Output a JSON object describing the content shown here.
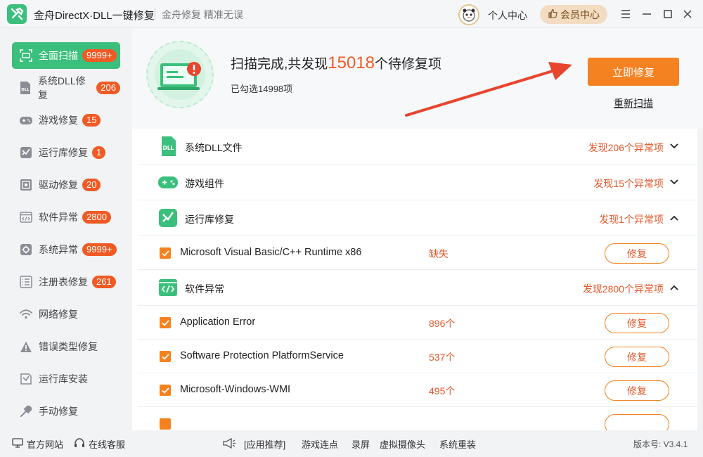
{
  "titlebar": {
    "app_title": "金舟DirectX·DLL一键修复",
    "slogan": "金舟修复 精准无误",
    "personal_center": "个人中心",
    "vip_center": "会员中心"
  },
  "sidebar": {
    "items": [
      {
        "label": "全面扫描",
        "badge": "9999+",
        "icon": "scan-icon"
      },
      {
        "label": "系统DLL修复",
        "badge": "206",
        "icon": "dll-icon"
      },
      {
        "label": "游戏修复",
        "badge": "15",
        "icon": "gamepad-icon"
      },
      {
        "label": "运行库修复",
        "badge": "1",
        "icon": "runtime-icon"
      },
      {
        "label": "驱动修复",
        "badge": "20",
        "icon": "driver-icon"
      },
      {
        "label": "软件异常",
        "badge": "2800",
        "icon": "code-icon"
      },
      {
        "label": "系统异常",
        "badge": "9999+",
        "icon": "gear-icon"
      },
      {
        "label": "注册表修复",
        "badge": "261",
        "icon": "registry-icon"
      },
      {
        "label": "网络修复",
        "badge": "",
        "icon": "wifi-icon"
      },
      {
        "label": "错误类型修复",
        "badge": "",
        "icon": "warning-icon"
      },
      {
        "label": "运行库安装",
        "badge": "",
        "icon": "install-icon"
      },
      {
        "label": "手动修复",
        "badge": "",
        "icon": "wrench-icon"
      }
    ]
  },
  "scan": {
    "title_prefix": "扫描完成,共发现",
    "count": "15018",
    "title_suffix": "个待修复项",
    "selected": "已勾选14998项",
    "fix_now": "立即修复",
    "rescan": "重新扫描"
  },
  "list": {
    "cat_dll": {
      "name": "系统DLL文件",
      "found": "发现206个异常项"
    },
    "cat_game": {
      "name": "游戏组件",
      "found": "发现15个异常项"
    },
    "cat_runtime": {
      "name": "运行库修复",
      "found": "发现1个异常项"
    },
    "runtime_items": [
      {
        "name": "Microsoft Visual Basic/C++ Runtime x86",
        "status": "缺失",
        "action": "修复"
      }
    ],
    "cat_software": {
      "name": "软件异常",
      "found": "发现2800个异常项"
    },
    "software_items": [
      {
        "name": "Application Error",
        "status": "896个",
        "action": "修复"
      },
      {
        "name": "Software Protection PlatformService",
        "status": "537个",
        "action": "修复"
      },
      {
        "name": "Microsoft-Windows-WMI",
        "status": "495个",
        "action": "修复"
      }
    ]
  },
  "footer": {
    "official_site": "官方网站",
    "online_service": "在线客服",
    "app_recommend": "[应用推荐]",
    "links": [
      "游戏连点",
      "录屏",
      "虚拟摄像头",
      "系统重装"
    ],
    "version": "版本号: V3.4.1"
  },
  "colors": {
    "accent_green": "#3bbf7c",
    "accent_orange": "#f58220",
    "badge_red": "#f15a24"
  }
}
